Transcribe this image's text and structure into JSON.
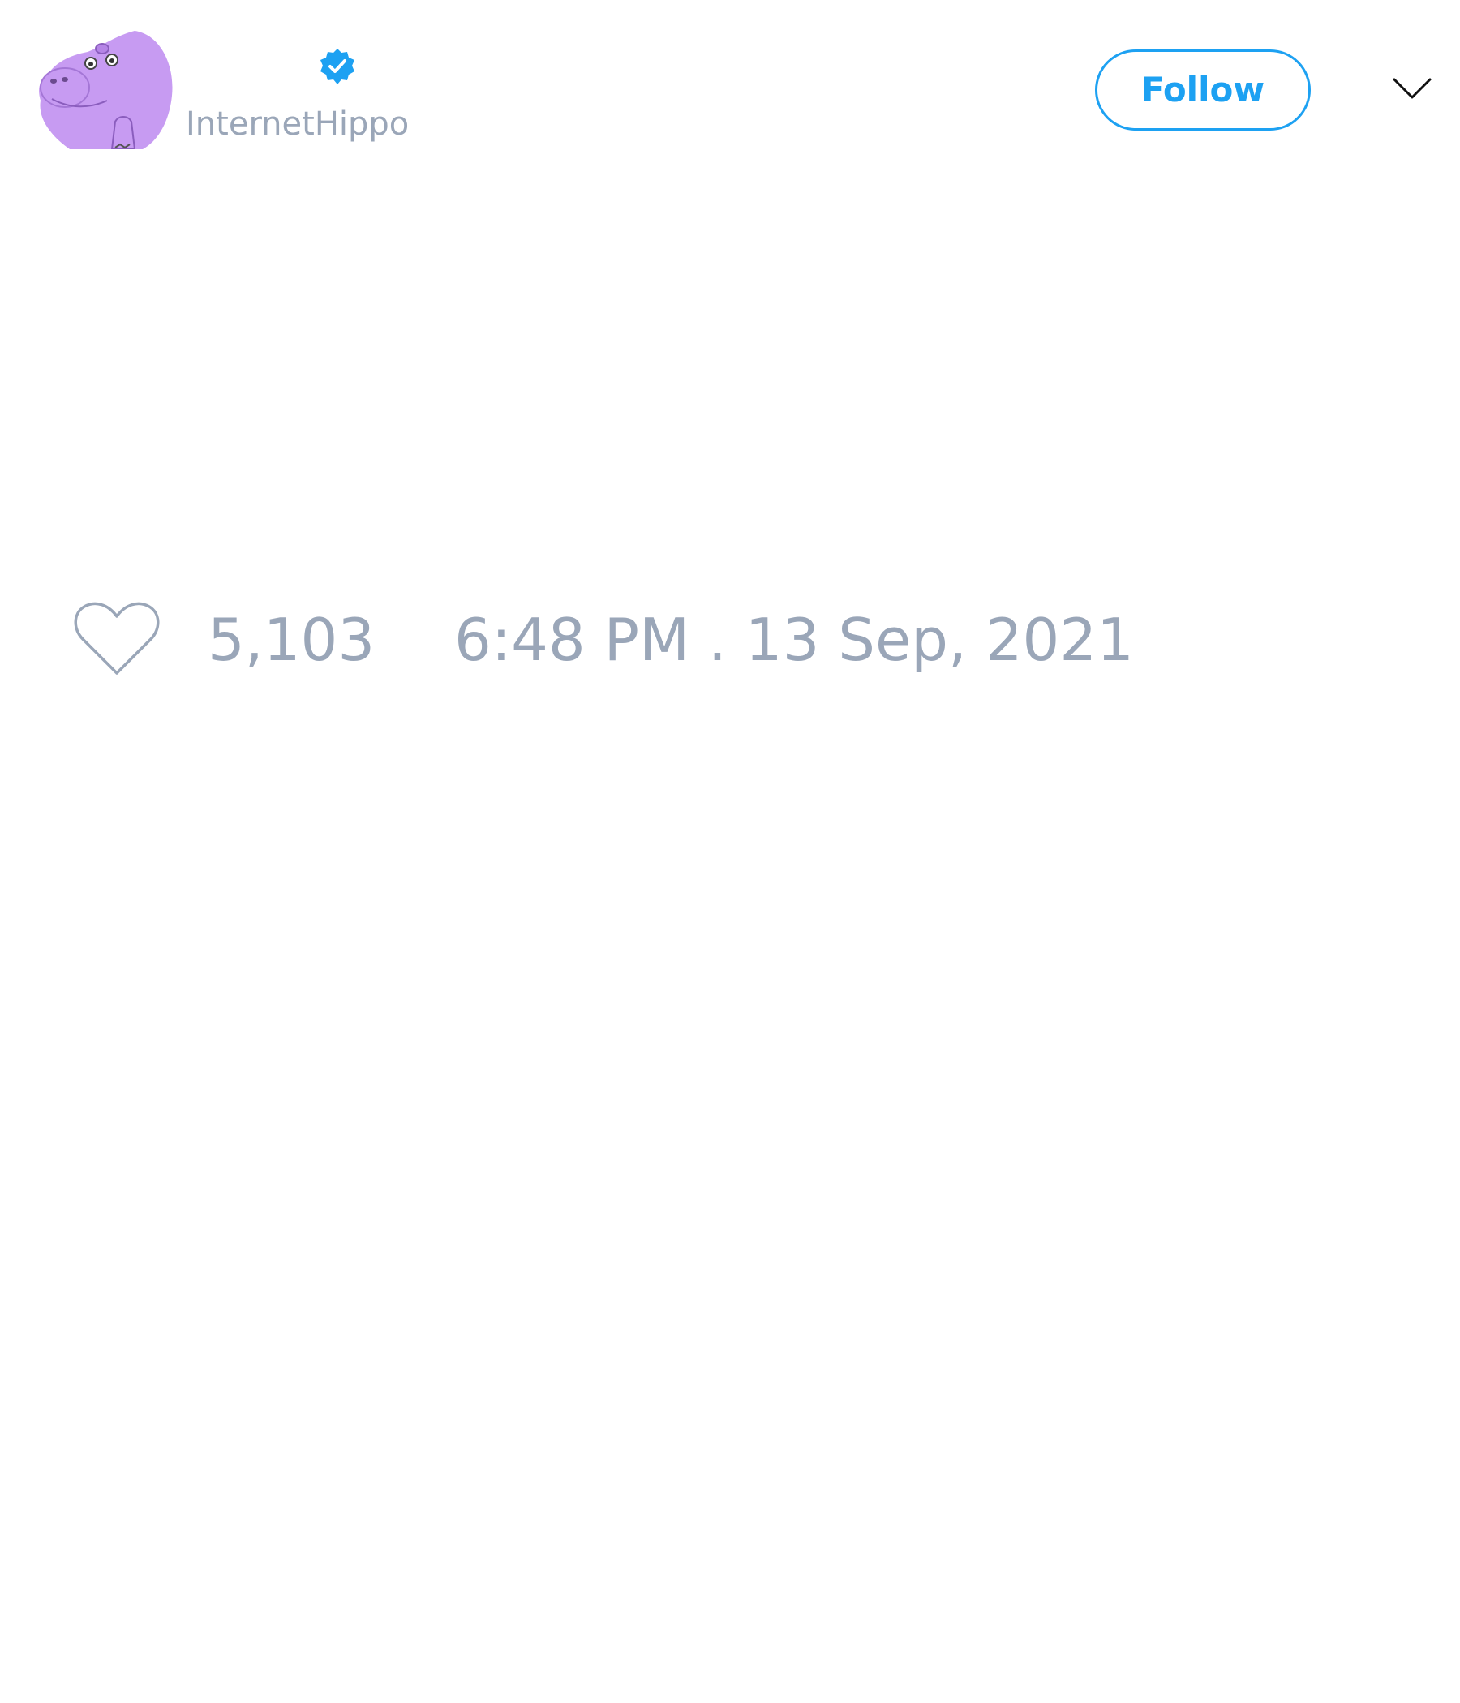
{
  "user": {
    "handle": "InternetHippo",
    "verified": true,
    "avatar_icon": "purple-hippo-avatar"
  },
  "header": {
    "follow_label": "Follow",
    "menu_icon": "chevron-down-icon"
  },
  "footer": {
    "like_icon": "heart-icon",
    "like_count": "5,103",
    "timestamp": "6:48 PM . 13 Sep, 2021"
  },
  "colors": {
    "accent": "#1da1f2",
    "muted_text": "#9aa6b8",
    "avatar_fill": "#c79bf2",
    "background": "#ffffff"
  }
}
